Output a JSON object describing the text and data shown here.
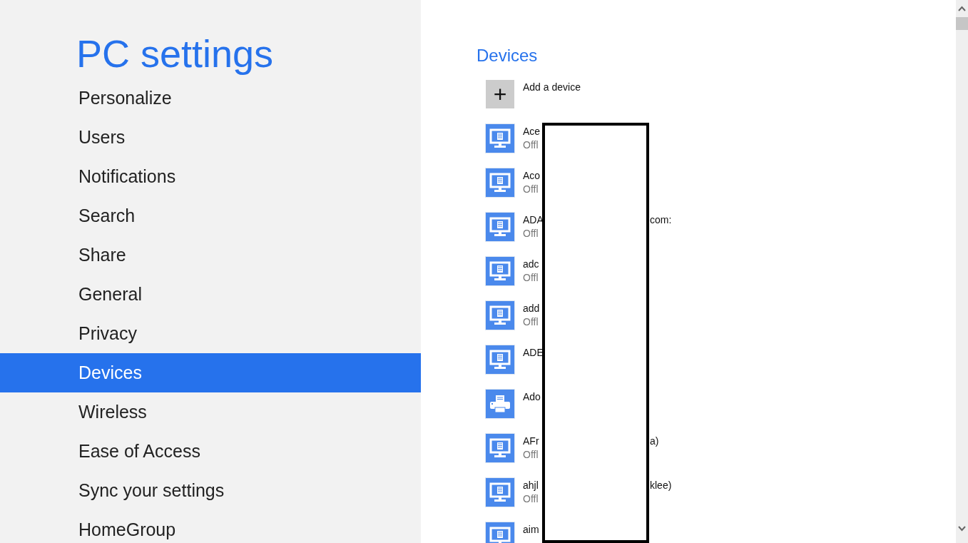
{
  "sidebar": {
    "title": "PC settings",
    "items": [
      {
        "label": "Personalize",
        "selected": false
      },
      {
        "label": "Users",
        "selected": false
      },
      {
        "label": "Notifications",
        "selected": false
      },
      {
        "label": "Search",
        "selected": false
      },
      {
        "label": "Share",
        "selected": false
      },
      {
        "label": "General",
        "selected": false
      },
      {
        "label": "Privacy",
        "selected": false
      },
      {
        "label": "Devices",
        "selected": true
      },
      {
        "label": "Wireless",
        "selected": false
      },
      {
        "label": "Ease of Access",
        "selected": false
      },
      {
        "label": "Sync your settings",
        "selected": false
      },
      {
        "label": "HomeGroup",
        "selected": false
      }
    ]
  },
  "content": {
    "heading": "Devices",
    "add_device": {
      "icon": "+",
      "label": "Add a device"
    },
    "devices": [
      {
        "kind": "monitor",
        "name": "Ace",
        "status": "Offl"
      },
      {
        "kind": "monitor",
        "name": "Aco",
        "status": "Offl"
      },
      {
        "kind": "monitor",
        "name": "ADA",
        "name_tail": "com:",
        "status": "Offl"
      },
      {
        "kind": "monitor",
        "name": "adc",
        "status": "Offl"
      },
      {
        "kind": "monitor",
        "name": "add",
        "status": "Offl"
      },
      {
        "kind": "monitor",
        "name": "ADE"
      },
      {
        "kind": "printer",
        "name": "Ado"
      },
      {
        "kind": "monitor",
        "name": "AFr",
        "name_tail": "a)",
        "status": "Offl"
      },
      {
        "kind": "monitor",
        "name": "ahjl",
        "name_tail": "klee)",
        "status": "Offl"
      },
      {
        "kind": "monitor",
        "name": "aim"
      }
    ]
  }
}
